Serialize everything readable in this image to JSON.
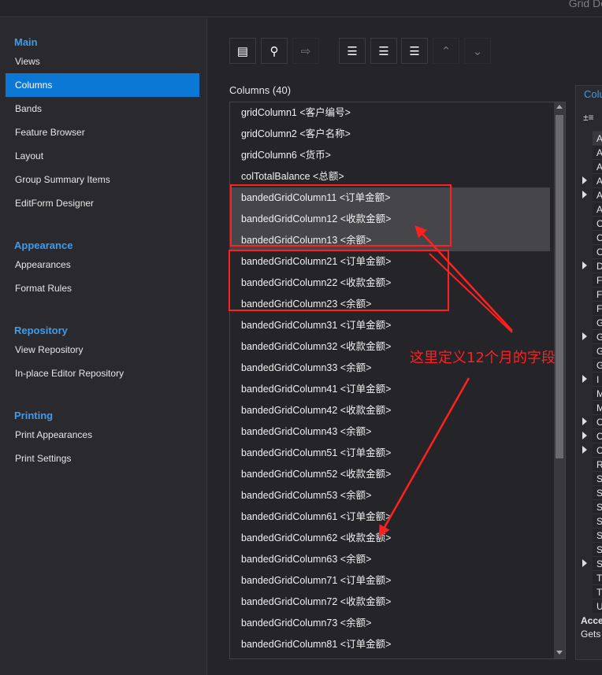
{
  "window": {
    "title": "Grid De"
  },
  "sidebar": {
    "groups": [
      {
        "label": "Main",
        "items": [
          "Views",
          "Columns",
          "Bands",
          "Feature Browser",
          "Layout",
          "Group Summary Items",
          "EditForm Designer"
        ]
      },
      {
        "label": "Appearance",
        "items": [
          "Appearances",
          "Format Rules"
        ]
      },
      {
        "label": "Repository",
        "items": [
          "View Repository",
          "In-place Editor Repository"
        ]
      },
      {
        "label": "Printing",
        "items": [
          "Print Appearances",
          "Print Settings"
        ]
      }
    ],
    "selected": "Columns"
  },
  "toolbar": {
    "buttons": [
      {
        "icon": "show-designer-icon",
        "enabled": true
      },
      {
        "icon": "search-icon",
        "enabled": true
      },
      {
        "icon": "retrieve-fields-icon",
        "enabled": false
      },
      {
        "icon": "add-column-icon",
        "enabled": true
      },
      {
        "icon": "insert-column-icon",
        "enabled": true
      },
      {
        "icon": "remove-column-icon",
        "enabled": true
      },
      {
        "icon": "move-up-icon",
        "enabled": false
      },
      {
        "icon": "move-down-icon",
        "enabled": false
      }
    ]
  },
  "columns": {
    "label": "Columns (40)",
    "items": [
      "gridColumn1 <客户编号>",
      "gridColumn2 <客户名称>",
      "gridColumn6 <货币>",
      "colTotalBalance <总额>",
      "bandedGridColumn11 <订单金额>",
      "bandedGridColumn12 <收款金额>",
      "bandedGridColumn13 <余额>",
      "bandedGridColumn21 <订单金额>",
      "bandedGridColumn22 <收款金额>",
      "bandedGridColumn23 <余额>",
      "bandedGridColumn31 <订单金额>",
      "bandedGridColumn32 <收款金额>",
      "bandedGridColumn33 <余额>",
      "bandedGridColumn41 <订单金额>",
      "bandedGridColumn42 <收款金额>",
      "bandedGridColumn43 <余额>",
      "bandedGridColumn51 <订单金额>",
      "bandedGridColumn52 <收款金额>",
      "bandedGridColumn53 <余额>",
      "bandedGridColumn61 <订单金额>",
      "bandedGridColumn62 <收款金额>",
      "bandedGridColumn63 <余额>",
      "bandedGridColumn71 <订单金额>",
      "bandedGridColumn72 <收款金额>",
      "bandedGridColumn73 <余额>",
      "bandedGridColumn81 <订单金额>"
    ],
    "selected": [
      4,
      5,
      6
    ]
  },
  "properties": {
    "tab": "Colu",
    "rows": [
      {
        "t": "A"
      },
      {
        "t": "A"
      },
      {
        "t": "A"
      },
      {
        "t": "A",
        "e": 1
      },
      {
        "t": "A",
        "e": 1
      },
      {
        "t": "A"
      },
      {
        "t": "C"
      },
      {
        "t": "C"
      },
      {
        "t": "C"
      },
      {
        "t": "D",
        "e": 1
      },
      {
        "t": "F"
      },
      {
        "t": "F"
      },
      {
        "t": "F"
      },
      {
        "t": "G"
      },
      {
        "t": "G",
        "e": 1
      },
      {
        "t": "G"
      },
      {
        "t": "G"
      },
      {
        "t": "I",
        "e": 1
      },
      {
        "t": "M"
      },
      {
        "t": "M"
      },
      {
        "t": "C",
        "e": 1
      },
      {
        "t": "C",
        "e": 1
      },
      {
        "t": "C",
        "e": 1
      },
      {
        "t": "R"
      },
      {
        "t": "S"
      },
      {
        "t": "S"
      },
      {
        "t": "S"
      },
      {
        "t": "S"
      },
      {
        "t": "S"
      },
      {
        "t": "S"
      },
      {
        "t": "S",
        "e": 1
      },
      {
        "t": "T"
      },
      {
        "t": "T"
      },
      {
        "t": "U"
      }
    ],
    "desc_title": "Acce",
    "desc_text": "Gets"
  },
  "annotation": {
    "text": "这里定义12个月的字段",
    "color": "#ff2020"
  }
}
